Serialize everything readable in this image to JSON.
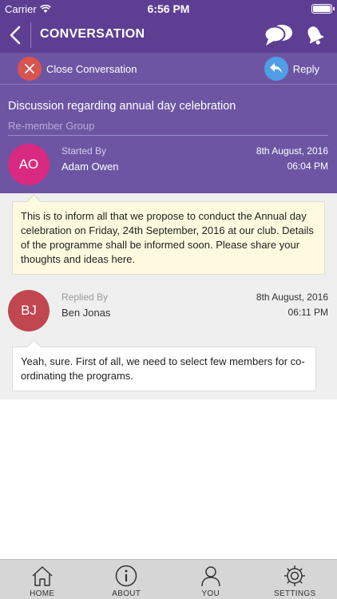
{
  "status_bar": {
    "carrier": "Carrier",
    "time": "6:56 PM"
  },
  "nav": {
    "title": "CONVERSATION",
    "icons": [
      "back-icon",
      "chat-bubbles-icon",
      "bell-icon"
    ]
  },
  "actions": {
    "close_label": "Close Conversation",
    "reply_label": "Reply"
  },
  "conversation": {
    "subject": "Discussion regarding annual day celebration",
    "group": "Re-member Group",
    "started": {
      "label": "Started By",
      "initials": "AO",
      "name": "Adam  Owen",
      "date": "8th August, 2016",
      "time": "06:04 PM",
      "message": "This is to inform all that we propose to conduct the Annual day celebration on Friday, 24th September, 2016 at our club. Details of the programme shall be informed soon. Please share your thoughts and ideas here.",
      "avatar_color": "#d72a80"
    },
    "reply": {
      "label": "Replied By",
      "initials": "BJ",
      "name": "Ben  Jonas",
      "date": "8th August, 2016",
      "time": "06:11 PM",
      "message": "Yeah, sure. First of all, we need to select few members for co-ordinating the programs.",
      "avatar_color": "#c0464f"
    }
  },
  "tabs": [
    {
      "label": "HOME",
      "icon": "home-icon"
    },
    {
      "label": "ABOUT",
      "icon": "info-icon"
    },
    {
      "label": "YOU",
      "icon": "user-icon"
    },
    {
      "label": "SETTINGS",
      "icon": "gear-icon"
    }
  ],
  "colors": {
    "primary": "#5e3e93",
    "panel": "#6d55a3",
    "close": "#d9534f",
    "reply": "#4f9ee6"
  }
}
